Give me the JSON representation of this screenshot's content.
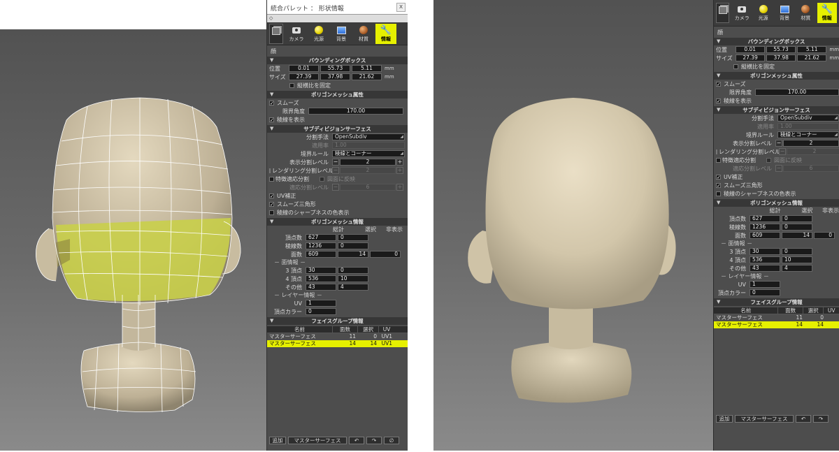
{
  "palette": {
    "title": "統合パレット ： 形状情報",
    "close": "x",
    "pin": "◇",
    "tabs": [
      {
        "label": "カメラ",
        "icon": "camera-icon"
      },
      {
        "label": "光源",
        "icon": "light-icon"
      },
      {
        "label": "背景",
        "icon": "background-icon"
      },
      {
        "label": "材質",
        "icon": "material-icon"
      },
      {
        "label": "情報",
        "icon": "wrench-icon",
        "selected": true
      }
    ],
    "object_name": "顔",
    "bbox": {
      "header": "バウンディングボックス",
      "position_label": "位置",
      "size_label": "サイズ",
      "position": [
        "0.01",
        "55.73",
        "5.11"
      ],
      "size": [
        "27.39",
        "37.98",
        "21.62"
      ],
      "unit": "mm",
      "lock_ratio": "縦横比を固定"
    },
    "polymesh_attr": {
      "header": "ポリゴンメッシュ属性",
      "smooth": "スムーズ",
      "angle_label": "限界角度",
      "angle": "170.00",
      "show_edges": "稜線を表示"
    },
    "subdiv": {
      "header": "サブディビジョンサーフェス",
      "method_label": "分割手法",
      "method": "OpenSubdiv",
      "rate_label": "適用率",
      "rate": "1.00",
      "boundary_label": "境界ルール",
      "boundary": "稜線とコーナー",
      "display_level_label": "表示分割レベル",
      "display_level": "2",
      "render_level_label": "レンダリング分割レベル",
      "render_level": "2",
      "adaptive_label": "特徴適応分割",
      "reflect_label": "図面に反映",
      "adaptive_level_label": "適応分割レベル",
      "adaptive_level": "6",
      "uv_fix": "UV補正",
      "smooth_tri": "スムーズ三角形",
      "edge_color": "稜線のシャープネスの色表示"
    },
    "polymesh_info": {
      "header": "ポリゴンメッシュ情報",
      "col_total": "総計",
      "col_selected": "選択",
      "col_hidden": "非表示",
      "vertices_label": "頂点数",
      "vertices": [
        "627",
        "0"
      ],
      "edges_label": "稜線数",
      "edges": [
        "1236",
        "0"
      ],
      "faces_label": "面数",
      "faces": [
        "609",
        "14",
        "0"
      ],
      "face_info": "－ 面情報 －",
      "tri_label": "3 頂点",
      "tri": [
        "30",
        "0"
      ],
      "quad_label": "4 頂点",
      "quad": [
        "536",
        "10"
      ],
      "other_label": "その他",
      "other": [
        "43",
        "4"
      ],
      "layer_info": "－ レイヤー情報 －",
      "uv_label": "UV",
      "uv": "1",
      "vcolor_label": "頂点カラー",
      "vcolor": "0"
    },
    "facegroup": {
      "header": "フェイスグループ情報",
      "col_name": "名前",
      "col_faces": "面数",
      "col_selected": "選択",
      "col_uv": "UV",
      "rows": [
        {
          "name": "マスターサーフェス",
          "faces": "11",
          "selected": "0",
          "uv": "UV1"
        },
        {
          "name": "マスターサーフェス",
          "faces": "14",
          "selected": "14",
          "uv": "UV1"
        }
      ]
    },
    "bottom": {
      "add": "追加",
      "surface": "マスターサーフェス",
      "undo": "↶",
      "redo": "↷",
      "delete": "∅"
    }
  },
  "colors": {
    "selection": "#e6f000",
    "skin": "#d9ccb0",
    "mask": "#c9cf4a"
  }
}
